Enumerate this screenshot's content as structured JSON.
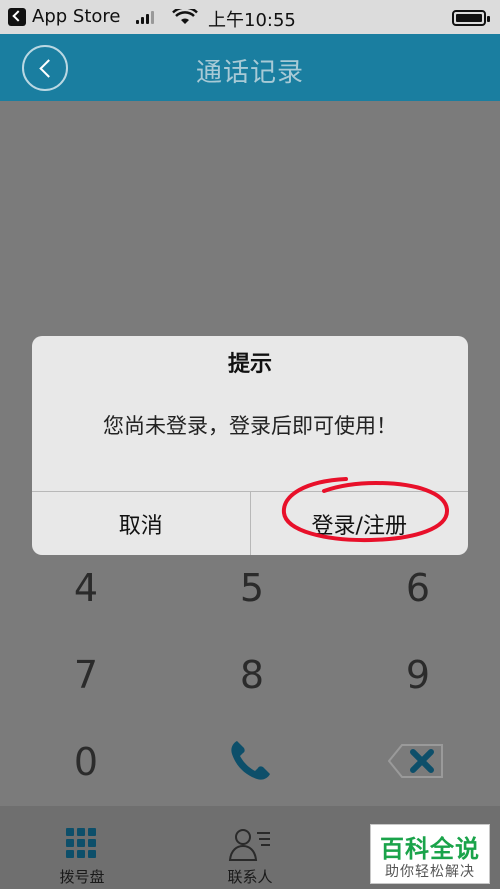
{
  "status_bar": {
    "back_app": "App Store",
    "time": "上午10:55"
  },
  "nav": {
    "title": "通话记录"
  },
  "keypad": {
    "row_top": [
      "4",
      "5",
      "6"
    ],
    "row_mid": [
      "7",
      "8",
      "9"
    ],
    "zero": "0",
    "call_icon": "phone-icon",
    "delete_icon": "backspace-icon"
  },
  "tabs": [
    {
      "label": "拨号盘",
      "icon": "grid-icon",
      "active": true
    },
    {
      "label": "联系人",
      "icon": "contact-icon",
      "active": false
    }
  ],
  "dialog": {
    "title": "提示",
    "message": "您尚未登录，登录后即可使用！",
    "cancel": "取消",
    "confirm": "登录/注册"
  },
  "watermark": {
    "title": "百科全说",
    "subtitle": "助你轻松解决"
  },
  "colors": {
    "header": "#1a7ea0",
    "highlight": "#e8102a",
    "watermark": "#1aa34a"
  }
}
